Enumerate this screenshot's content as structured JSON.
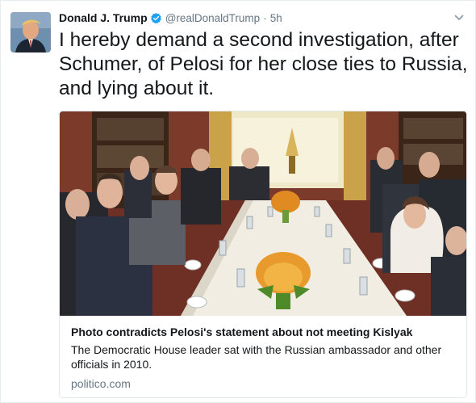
{
  "tweet": {
    "fullname": "Donald J. Trump",
    "screen_name": "@realDonaldTrump",
    "separator": "·",
    "timestamp": "5h",
    "text": "I hereby demand a second investigation, after Schumer, of Pelosi for her close ties to Russia, and lying about it.",
    "verified_icon": "verified-badge-icon",
    "caret_icon": "chevron-down-icon"
  },
  "card": {
    "title": "Photo contradicts Pelosi's statement about not meeting Kislyak",
    "description": "The Democratic House leader sat with the Russian ambassador and other officials in 2010.",
    "domain": "politico.com"
  },
  "colors": {
    "verified_blue": "#1da1f2",
    "secondary_text": "#657786",
    "border": "#e1e8ed"
  }
}
